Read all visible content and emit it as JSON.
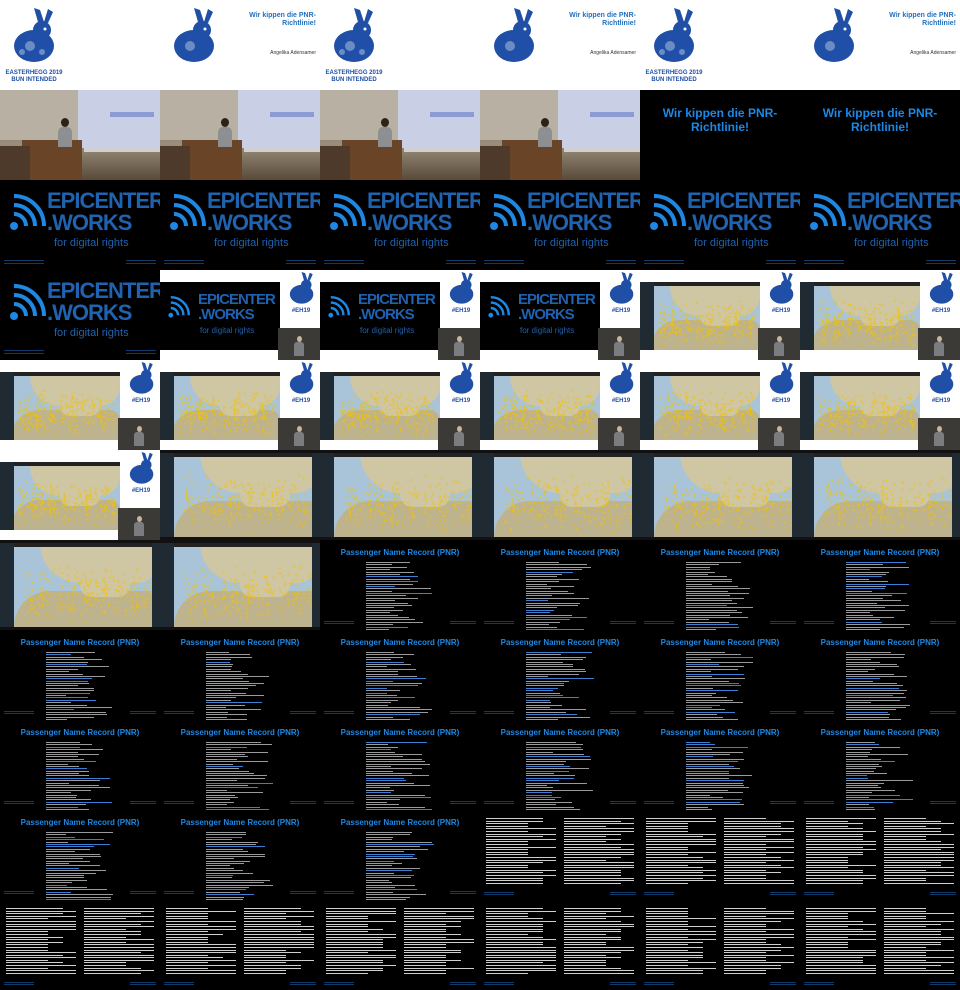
{
  "texts": {
    "event_line1": "EASTERHEGG 2019",
    "event_line2": "BUN INTENDED",
    "talk_title": "Wir kippen die PNR-Richtlinie!",
    "speaker": "Angelika Adensamer",
    "brand_line1": "EPICENTER",
    "brand_line2": ".WORKS",
    "brand_tagline": "for digital rights",
    "hashtag": "#EH19",
    "pnr_title": "Passenger Name Record (PNR)"
  },
  "colors": {
    "brand_blue": "#1f62b0",
    "title_blue": "#1e88e5",
    "logo_blue": "#1f4fa6",
    "slide_background": "#000000",
    "paper_white": "#ffffff",
    "plane_yellow": "#f2c200"
  },
  "icons": {
    "rabbit": "rabbit-logo-icon",
    "wifi": "epicenter-wifi-icon",
    "plane": "plane-marker-icon"
  },
  "tiles": [
    "logo",
    "title",
    "logo",
    "title",
    "logo",
    "title",
    "room",
    "room",
    "room",
    "room",
    "blackttl",
    "blackttl",
    "epi",
    "epi",
    "epi",
    "epi",
    "epi",
    "epi",
    "epi",
    "comp",
    "comp",
    "comp",
    "compmap",
    "compmap",
    "compmap",
    "compmap",
    "compmap",
    "compmap",
    "compmap",
    "compmap",
    "compmap",
    "mapfull",
    "mapfull",
    "mapfull",
    "mapfull",
    "mapfull",
    "mapfull",
    "mapfull",
    "pnr",
    "pnr",
    "pnr",
    "pnr",
    "pnr",
    "pnr",
    "pnr",
    "pnr",
    "pnr",
    "pnr",
    "pnr",
    "pnr",
    "pnr",
    "pnr",
    "pnr",
    "pnr",
    "pnr",
    "pnr",
    "pnr",
    "list",
    "list",
    "list",
    "list",
    "list",
    "list",
    "list",
    "list",
    "list"
  ]
}
